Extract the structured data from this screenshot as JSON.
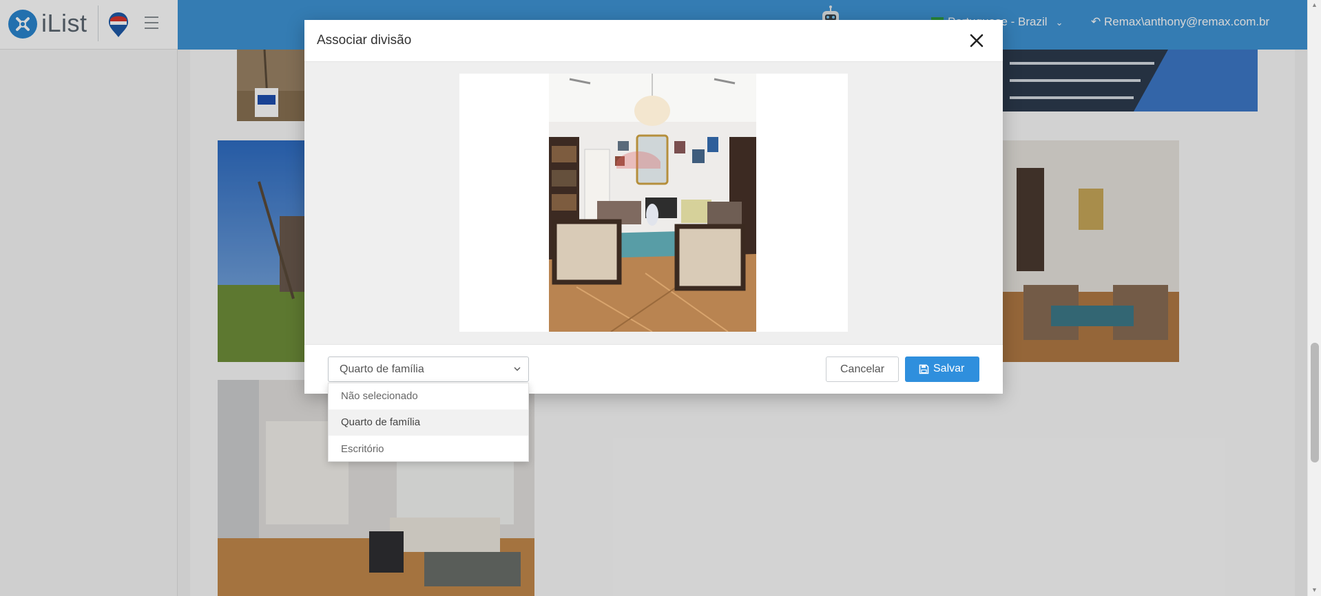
{
  "header": {
    "logo_text": "iList",
    "language": "Portuguese - Brazil",
    "user": "Remax\\anthony@remax.com.br"
  },
  "modal": {
    "title": "Associar divisão",
    "select": {
      "value": "Quarto de família",
      "options": [
        "Não selecionado",
        "Quarto de família",
        "Escritório"
      ],
      "highlighted_index": 1
    },
    "cancel_label": "Cancelar",
    "save_label": "Salvar"
  },
  "colors": {
    "header_blue": "#3f94d6",
    "primary_button": "#2f8fdd"
  },
  "icons": {
    "logo": "ilist-logo-icon",
    "brand": "remax-balloon-icon",
    "menu": "hamburger-menu-icon",
    "assistant": "robot-icon",
    "close": "close-icon",
    "select": "chevron-down-icon",
    "save": "floppy-disk-icon",
    "user": "reply-arrow-icon"
  }
}
